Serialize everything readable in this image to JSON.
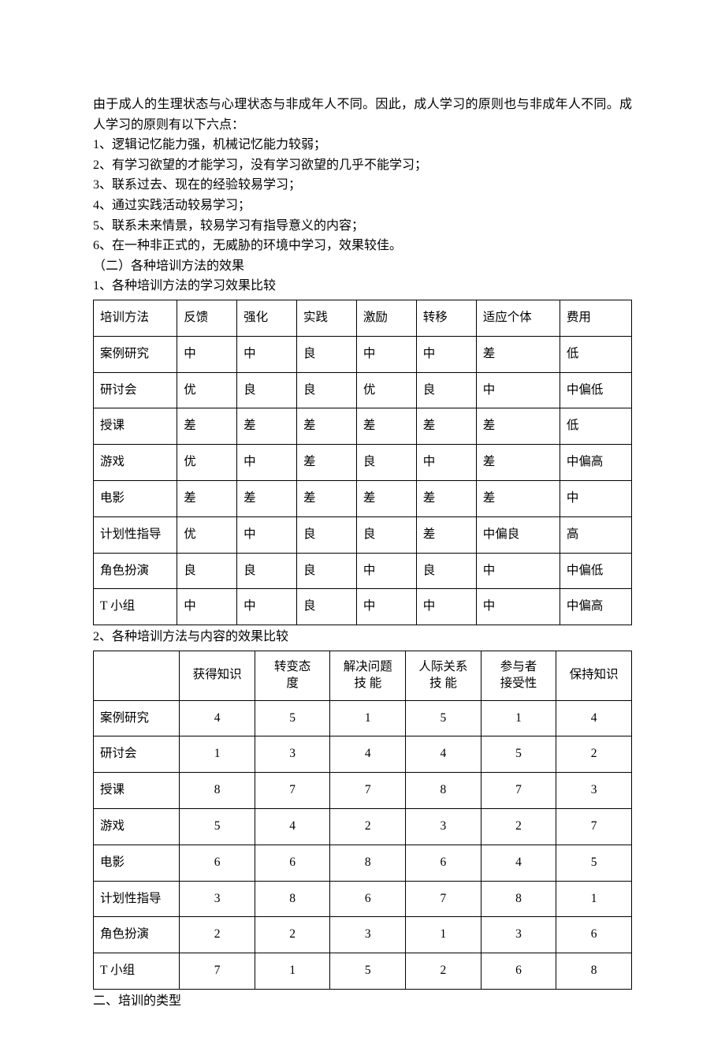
{
  "intro": {
    "p1": "由于成人的生理状态与心理状态与非成年人不同。因此，成人学习的原则也与非成年人不同。成人学习的原则有以下六点：",
    "li1": "1、逻辑记忆能力强，机械记忆能力较弱；",
    "li2": "2、有学习欲望的才能学习，没有学习欲望的几乎不能学习；",
    "li3": "3、联系过去、现在的经验较易学习；",
    "li4": "4、通过实践活动较易学习；",
    "li5": "5、联系未来情景，较易学习有指导意义的内容；",
    "li6": "6、在一种非正式的，无威胁的环境中学习，效果较佳。",
    "h2": "（二）各种培训方法的效果",
    "t1cap": "1、各种培训方法的学习效果比较"
  },
  "table1": {
    "headers": [
      "培训方法",
      "反馈",
      "强化",
      "实践",
      "激励",
      "转移",
      "适应个体",
      "费用"
    ],
    "rows": [
      [
        "案例研究",
        "中",
        "中",
        "良",
        "中",
        "中",
        "差",
        "低"
      ],
      [
        "研讨会",
        "优",
        "良",
        "良",
        "优",
        "良",
        "中",
        "中偏低"
      ],
      [
        "授课",
        "差",
        "差",
        "差",
        "差",
        "差",
        "差",
        "低"
      ],
      [
        "游戏",
        "优",
        "中",
        "差",
        "良",
        "中",
        "差",
        "中偏高"
      ],
      [
        "电影",
        "差",
        "差",
        "差",
        "差",
        "差",
        "差",
        "中"
      ],
      [
        "计划性指导",
        "优",
        "中",
        "良",
        "良",
        "差",
        "中偏良",
        "高"
      ],
      [
        "角色扮演",
        "良",
        "良",
        "良",
        "中",
        "良",
        "中",
        "中偏低"
      ],
      [
        "T 小组",
        "中",
        "中",
        "良",
        "中",
        "中",
        "中",
        "中偏高"
      ]
    ]
  },
  "mid": {
    "t2cap": "2、各种培训方法与内容的效果比较"
  },
  "table2": {
    "headers": [
      "",
      "获得知识",
      "转变态\n度",
      "解决问题\n技 能",
      "人际关系\n技 能",
      "参与者\n接受性",
      "保持知识"
    ],
    "rows": [
      [
        "案例研究",
        "4",
        "5",
        "1",
        "5",
        "1",
        "4"
      ],
      [
        "研讨会",
        "1",
        "3",
        "4",
        "4",
        "5",
        "2"
      ],
      [
        "授课",
        "8",
        "7",
        "7",
        "8",
        "7",
        "3"
      ],
      [
        "游戏",
        "5",
        "4",
        "2",
        "3",
        "2",
        "7"
      ],
      [
        "电影",
        "6",
        "6",
        "8",
        "6",
        "4",
        "5"
      ],
      [
        "计划性指导",
        "3",
        "8",
        "6",
        "7",
        "8",
        "1"
      ],
      [
        "角色扮演",
        "2",
        "2",
        "3",
        "1",
        "3",
        "6"
      ],
      [
        "T 小组",
        "7",
        "1",
        "5",
        "2",
        "6",
        "8"
      ]
    ]
  },
  "footer": {
    "h": "二、培训的类型"
  }
}
